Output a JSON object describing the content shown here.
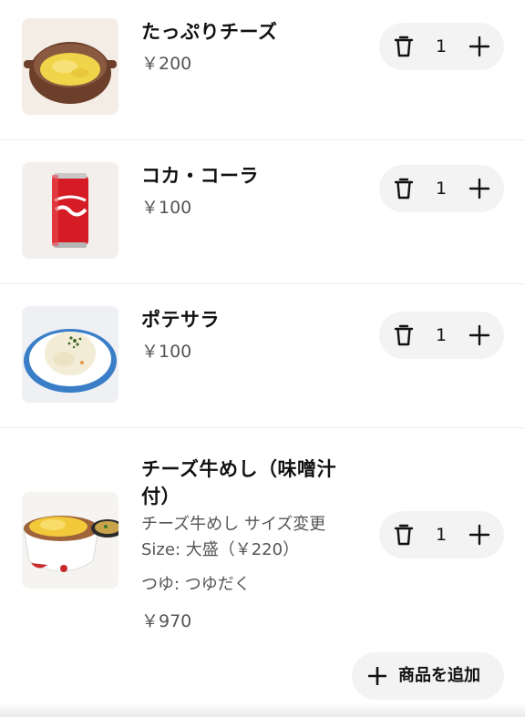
{
  "cart": {
    "items": [
      {
        "name": "たっぷりチーズ",
        "price": "￥200",
        "quantity": "1",
        "image_icon": "cheese-pot-image"
      },
      {
        "name": "コカ・コーラ",
        "price": "￥100",
        "quantity": "1",
        "image_icon": "coca-cola-can-image"
      },
      {
        "name": "ポテサラ",
        "price": "￥100",
        "quantity": "1",
        "image_icon": "potato-salad-image"
      },
      {
        "name": "チーズ牛めし（味噌汁付）",
        "options": [
          "チーズ牛めし サイズ変更",
          "Size: 大盛（￥220）",
          "つゆ: つゆだく"
        ],
        "price": "￥970",
        "quantity": "1",
        "image_icon": "cheese-beef-bowl-image"
      }
    ],
    "add_button_label": "商品を追加"
  },
  "icons": {
    "delete": "trash-icon",
    "increment": "plus-icon"
  },
  "colors": {
    "text_primary": "#111111",
    "text_secondary": "#555555",
    "control_bg": "#f3f3f3",
    "divider": "#ececec"
  }
}
